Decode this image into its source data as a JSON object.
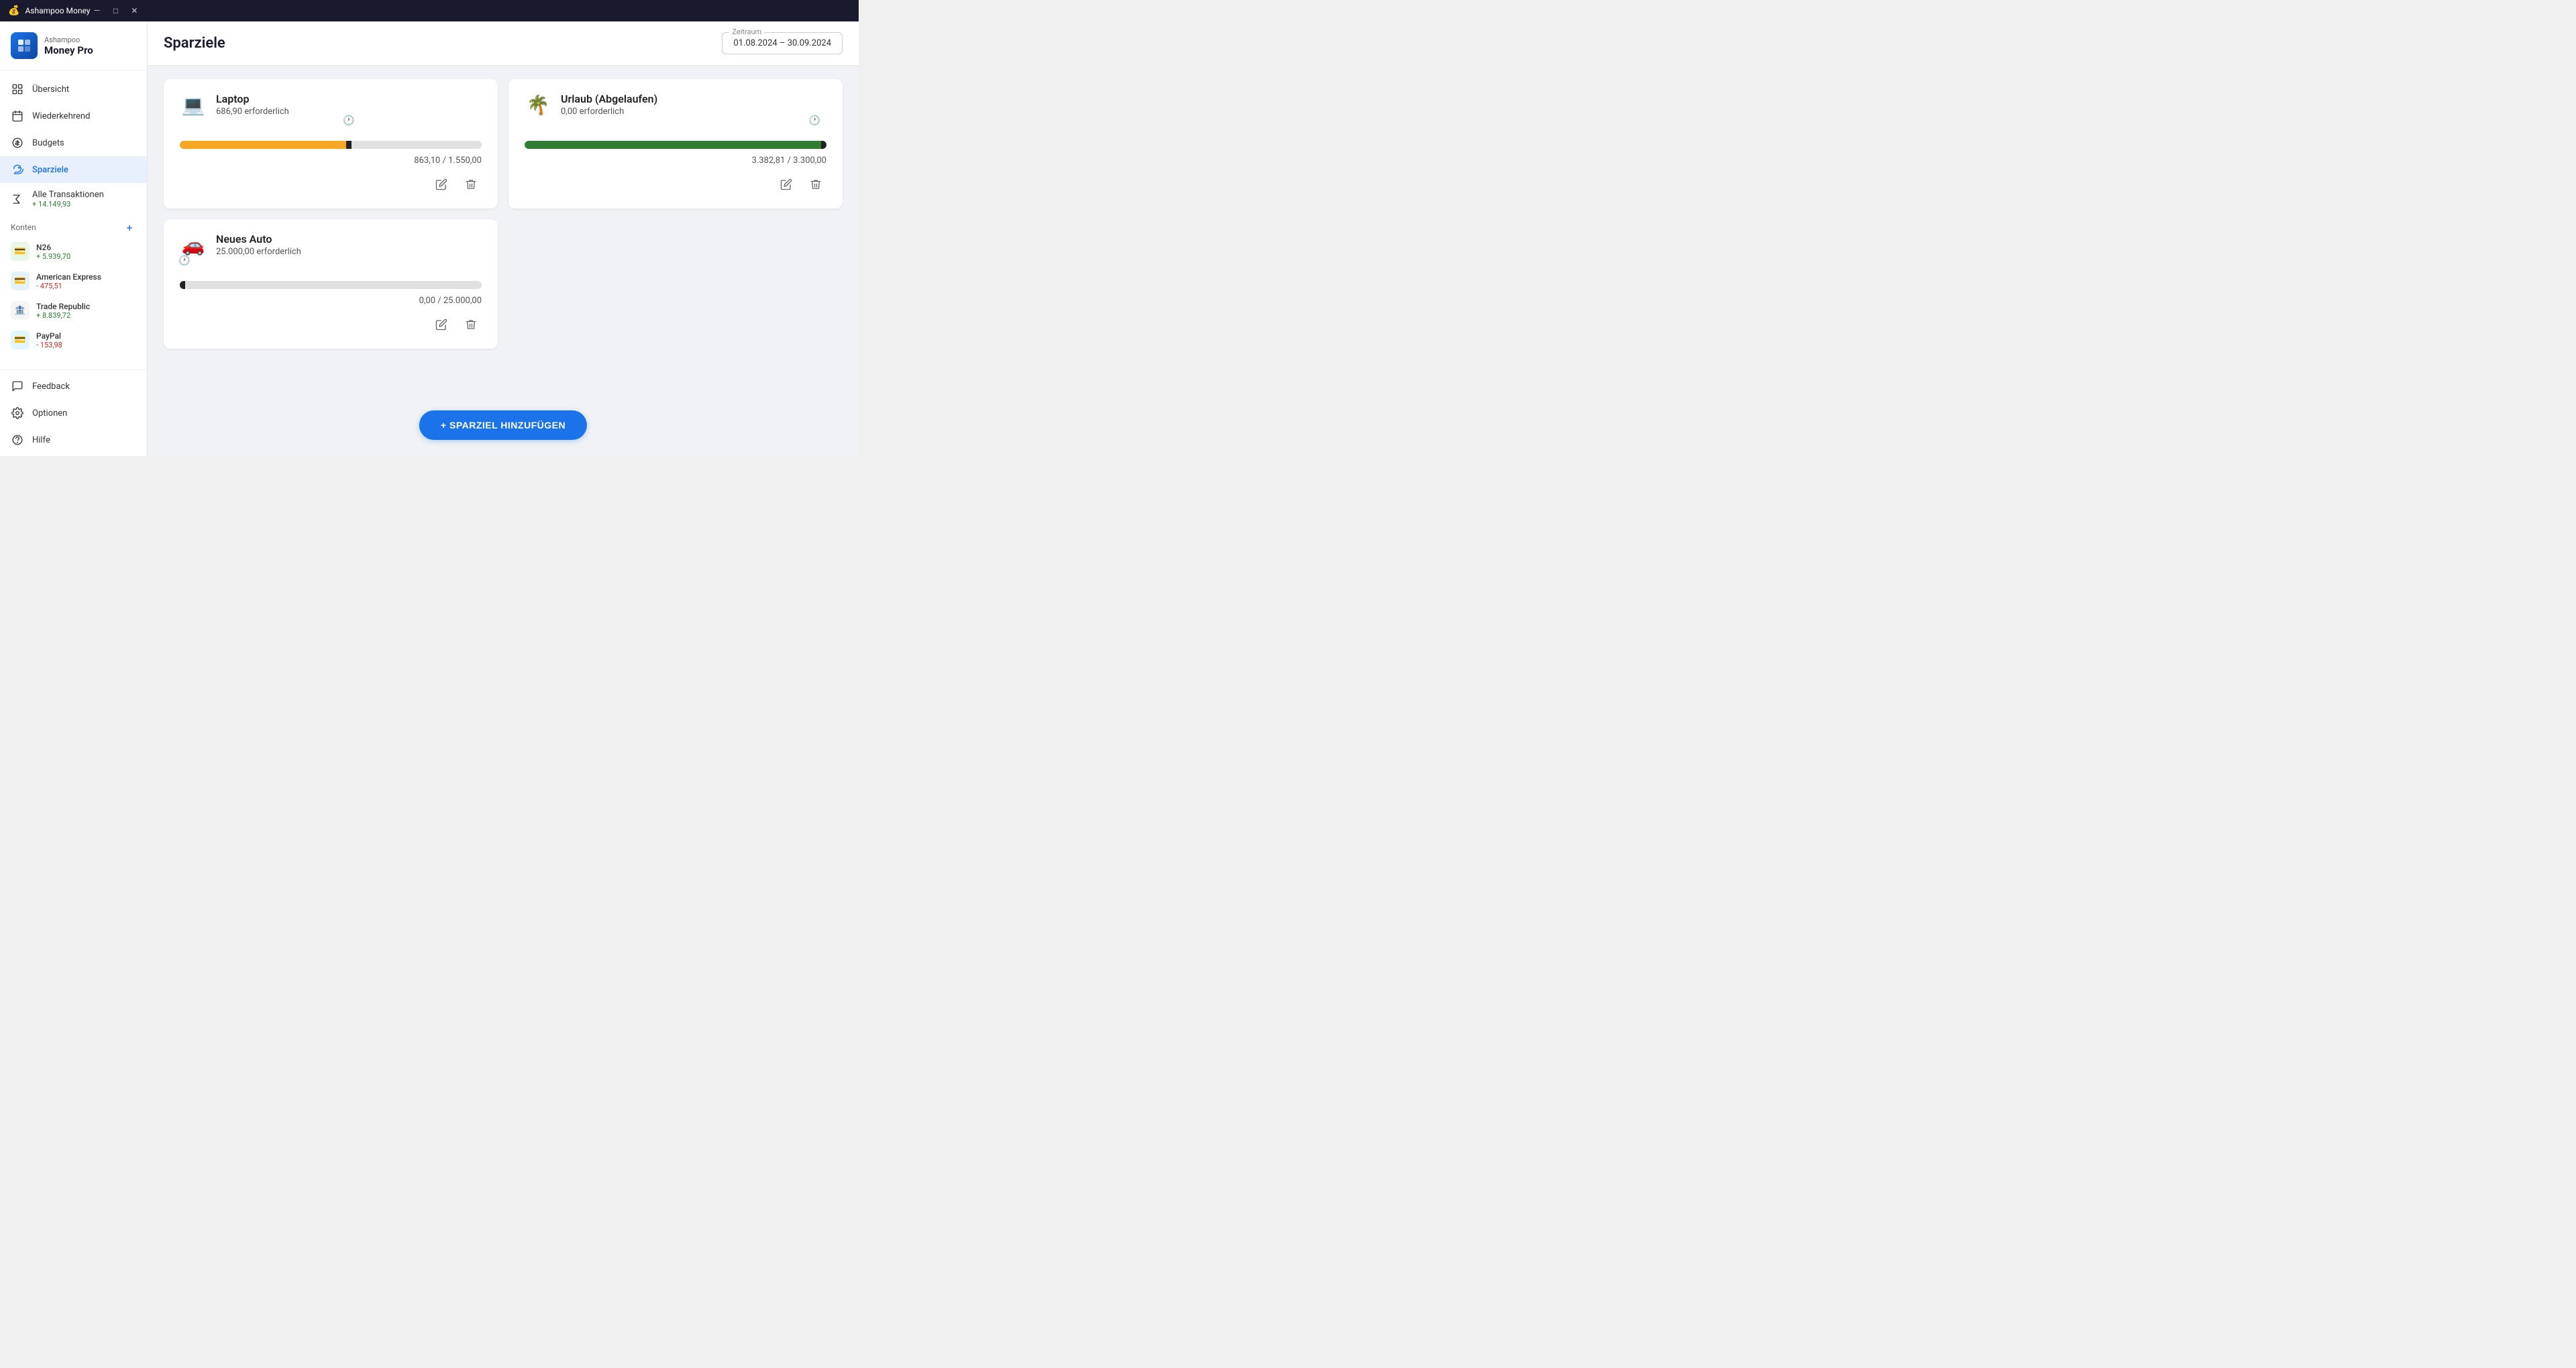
{
  "titleBar": {
    "appName": "Ashampoo Money",
    "controls": {
      "minimize": "—",
      "maximize": "□",
      "close": "✕"
    }
  },
  "sidebar": {
    "logo": {
      "company": "Ashampoo",
      "product": "Money Pro"
    },
    "navItems": [
      {
        "id": "uebersicht",
        "label": "Übersicht",
        "icon": "grid"
      },
      {
        "id": "wiederkehrend",
        "label": "Wiederkehrend",
        "icon": "calendar"
      },
      {
        "id": "budgets",
        "label": "Budgets",
        "icon": "dollar"
      },
      {
        "id": "sparziele",
        "label": "Sparziele",
        "icon": "piggy",
        "active": true
      }
    ],
    "transactions": {
      "label": "Alle Transaktionen",
      "value": "+ 14.149,93",
      "icon": "sigma"
    },
    "accountsHeader": "Konten",
    "addLabel": "+",
    "accounts": [
      {
        "id": "n26",
        "name": "N26",
        "balance": "+ 5.939,70",
        "positive": true,
        "icon": "💳",
        "iconClass": "green"
      },
      {
        "id": "amex",
        "name": "American Express",
        "balance": "- 475,51",
        "positive": false,
        "icon": "💳",
        "iconClass": "blue"
      },
      {
        "id": "trade",
        "name": "Trade Republic",
        "balance": "+ 8.839,72",
        "positive": true,
        "icon": "🏦",
        "iconClass": "gray"
      },
      {
        "id": "paypal",
        "name": "PayPal",
        "balance": "- 153,98",
        "positive": false,
        "icon": "💳",
        "iconClass": "lightblue"
      }
    ],
    "bottomItems": [
      {
        "id": "feedback",
        "label": "Feedback",
        "icon": "chat"
      },
      {
        "id": "optionen",
        "label": "Optionen",
        "icon": "gear"
      },
      {
        "id": "hilfe",
        "label": "Hilfe",
        "icon": "help"
      }
    ]
  },
  "header": {
    "title": "Sparziele",
    "zeitraumLabel": "Zeitraum",
    "zeitraumValue": "01.08.2024 – 30.09.2024"
  },
  "goals": [
    {
      "id": "laptop",
      "name": "Laptop",
      "required": "686,90 erforderlich",
      "emoji": "💻",
      "progressPercent": 55,
      "markerPercent": 56,
      "progressColor": "orange",
      "clockLeft": "55%",
      "current": "863,10",
      "target": "1.550,00",
      "values": "863,10 / 1.550,00",
      "clockIcon": "🕐"
    },
    {
      "id": "urlaub",
      "name": "Urlaub (Abgelaufen)",
      "required": "0,00 erforderlich",
      "emoji": "🌴",
      "progressPercent": 100,
      "markerPercent": 99,
      "progressColor": "green",
      "clockLeft": "97%",
      "current": "3.382,81",
      "target": "3.300,00",
      "values": "3.382,81 / 3.300,00",
      "clockIcon": "🕐"
    },
    {
      "id": "neuesauto",
      "name": "Neues Auto",
      "required": "25.000,00 erforderlich",
      "emoji": "🚗",
      "progressPercent": 1,
      "markerPercent": 0.5,
      "progressColor": "gray",
      "clockLeft": "0%",
      "current": "0,00",
      "target": "25.000,00",
      "values": "0,00 / 25.000,00",
      "clockIcon": "🕐"
    }
  ],
  "addButton": "+ SPARZIEL HINZUFÜGEN"
}
